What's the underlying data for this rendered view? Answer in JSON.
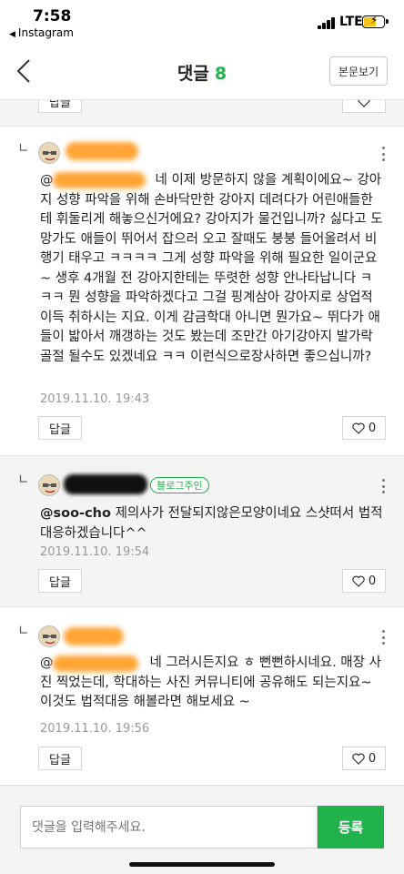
{
  "status_bar": {
    "time": "7:58",
    "back_app": "Instagram",
    "network": "LTE",
    "battery_level": 0.6
  },
  "header": {
    "title": "댓글",
    "count": "8",
    "view_original": "본문보기"
  },
  "top_partial": {
    "reply_label": "답글"
  },
  "comments": [
    {
      "text": "네 이제 방문하지 않을 계획이에요~ 강아지 성향 파악을 위해 손바닥만한 강아지 데려다가 어린애들한테 휘둘리게 해놓으신거에요? 강아지가 물건입니까? 싫다고 도망가도 애들이 뛰어서 잡으러 오고 잘때도 붕붕 들어올려서 비행기 태우고 ㅋㅋㅋㅋ 그게 성향 파악을 위해 필요한 일이군요~ 생후 4개월 전 강아지한테는 뚜렷한 성향 안나타납니다 ㅋㅋㅋ 뭔 성향을 파악하겠다고 그걸 핑계삼아 강아지로 상업적 이득 취하시는 지요. 이게 감금학대 아니면 뭔가요~ 뛰다가 애들이 밟아서 깨갱하는 것도 봤는데 조만간 아기강아지 발가락 골절 될수도 있겠네요 ㅋㅋ 이런식으로장사하면 좋으십니까?",
      "mention_prefix": "@",
      "date": "2019.11.10. 19:43",
      "reply_label": "답글",
      "likes": "0"
    },
    {
      "nickname_prefix": "",
      "badge": "블로그주인",
      "mention": "@soo-cho",
      "text": "제의사가 전달되지않은모양이네요 스샷떠서 법적대응하겠습니다^^",
      "date": "2019.11.10. 19:54",
      "reply_label": "답글",
      "likes": "0"
    },
    {
      "mention_prefix": "@",
      "text": "네 그러시든지요 ㅎ 뻔뻔하시네요. 매장 사진 찍었는데, 학대하는 사진 커뮤니티에 공유해도 되는지요~ 이것도 법적대응 해볼라면 해보세요 ~",
      "date": "2019.11.10. 19:56",
      "reply_label": "답글",
      "likes": "0"
    }
  ],
  "input": {
    "placeholder": "댓글을 입력해주세요.",
    "submit_label": "등록"
  },
  "colors": {
    "accent": "#22b24c",
    "background_alt": "#f4f4f4"
  }
}
